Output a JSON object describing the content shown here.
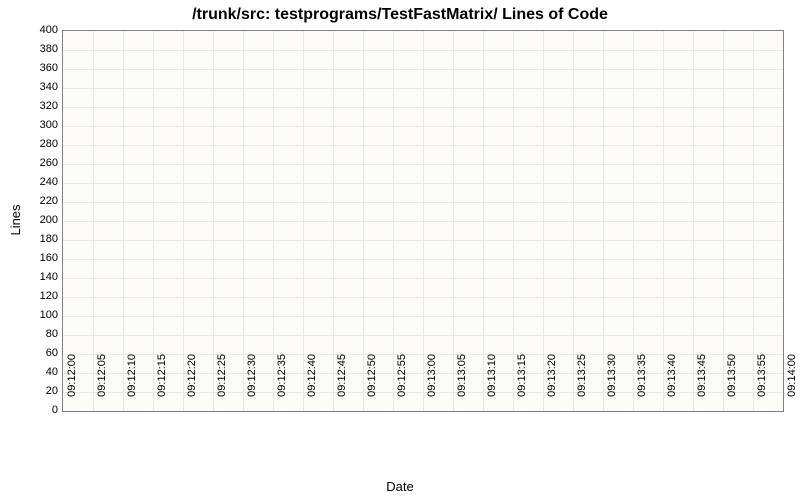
{
  "chart_data": {
    "type": "line",
    "title": "/trunk/src: testprograms/TestFastMatrix/ Lines of Code",
    "xlabel": "Date",
    "ylabel": "Lines",
    "ylim": [
      0,
      400
    ],
    "y_ticks": [
      0,
      20,
      40,
      60,
      80,
      100,
      120,
      140,
      160,
      180,
      200,
      220,
      240,
      260,
      280,
      300,
      320,
      340,
      360,
      380,
      400
    ],
    "x_ticks": [
      "09:12:00",
      "09:12:05",
      "09:12:10",
      "09:12:15",
      "09:12:20",
      "09:12:25",
      "09:12:30",
      "09:12:35",
      "09:12:40",
      "09:12:45",
      "09:12:50",
      "09:12:55",
      "09:13:00",
      "09:13:05",
      "09:13:10",
      "09:13:15",
      "09:13:20",
      "09:13:25",
      "09:13:30",
      "09:13:35",
      "09:13:40",
      "09:13:45",
      "09:13:50",
      "09:13:55",
      "09:14:00"
    ],
    "series": []
  }
}
